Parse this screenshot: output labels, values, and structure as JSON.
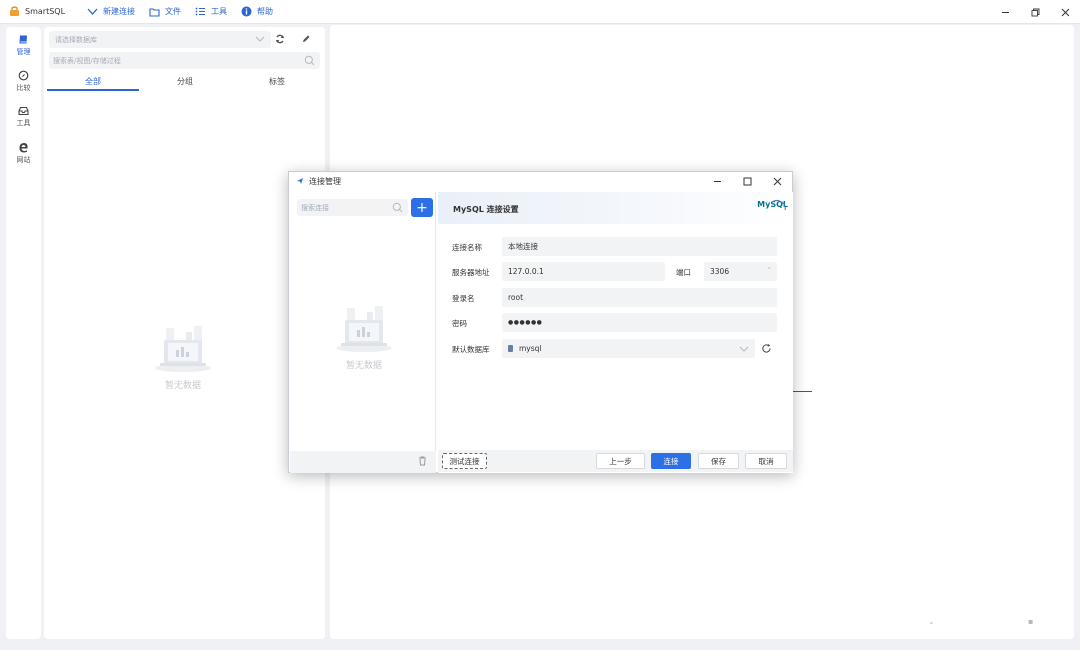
{
  "app": {
    "title": "SmartSQL",
    "menu": [
      {
        "label": "新建连接",
        "icon": "chevron-down-icon"
      },
      {
        "label": "文件",
        "icon": "folder-icon"
      },
      {
        "label": "工具",
        "icon": "list-icon"
      },
      {
        "label": "帮助",
        "icon": "info-icon"
      }
    ],
    "window_controls": [
      "minimize",
      "restore",
      "close"
    ]
  },
  "nav": {
    "items": [
      {
        "label": "管理",
        "icon": "book-icon",
        "active": true
      },
      {
        "label": "比较",
        "icon": "compass-icon",
        "active": false
      },
      {
        "label": "工具",
        "icon": "inbox-icon",
        "active": false
      },
      {
        "label": "网站",
        "icon": "edge-icon",
        "active": false
      }
    ]
  },
  "tree": {
    "db_select_placeholder": "请选择数据库",
    "search_placeholder": "搜索表/视图/存储过程",
    "tabs": [
      {
        "label": "全部",
        "active": true
      },
      {
        "label": "分组",
        "active": false
      },
      {
        "label": "标签",
        "active": false
      }
    ],
    "empty_text": "暂无数据"
  },
  "dialog": {
    "title": "连接管理",
    "search_placeholder": "搜索连接",
    "add_label": "+",
    "empty_text": "暂无数据",
    "settings_title": "MySQL 连接设置",
    "logo_text": "MySQL",
    "form": {
      "name_label": "连接名称",
      "name_value": "本地连接",
      "host_label": "服务器地址",
      "host_value": "127.0.0.1",
      "port_label": "端口",
      "port_value": "3306",
      "user_label": "登录名",
      "user_value": "root",
      "password_label": "密码",
      "password_value": "●●●●●●",
      "db_label": "默认数据库",
      "db_value": "mysql"
    },
    "buttons": {
      "test": "测试连接",
      "prev": "上一步",
      "connect": "连接",
      "save": "保存",
      "cancel": "取消"
    }
  },
  "colors": {
    "accent": "#2c70e6",
    "link": "#2c64d6",
    "field_bg": "#f2f3f5",
    "app_bg": "#f0f1f4"
  }
}
